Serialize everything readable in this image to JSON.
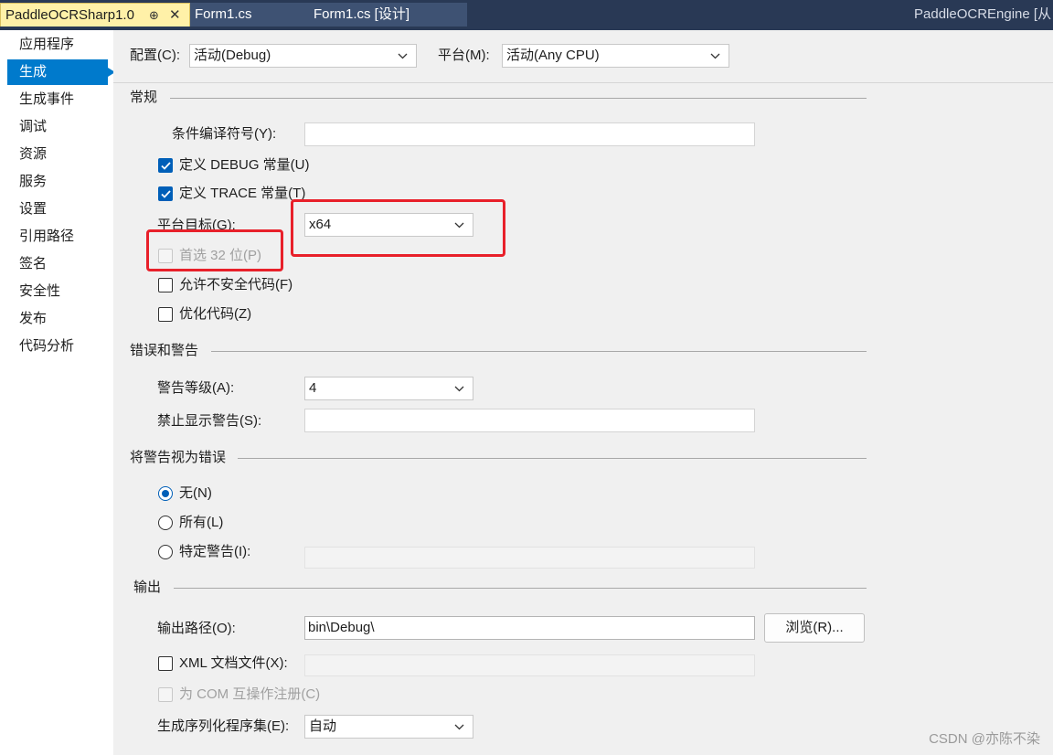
{
  "tabs": {
    "active": "PaddleOCRSharp1.0",
    "pin": "⊕",
    "close": "✕",
    "tab2": "Form1.cs",
    "tab3": "Form1.cs [设计]",
    "right_title": "PaddleOCREngine [从"
  },
  "sidebar": {
    "items": [
      "应用程序",
      "生成",
      "生成事件",
      "调试",
      "资源",
      "服务",
      "设置",
      "引用路径",
      "签名",
      "安全性",
      "发布",
      "代码分析"
    ],
    "selected": "生成"
  },
  "config": {
    "label": "配置(C):",
    "value": "活动(Debug)",
    "platform_label": "平台(M):",
    "platform_value": "活动(Any CPU)"
  },
  "general": {
    "title": "常规",
    "conditional_label": "条件编译符号(Y):",
    "conditional_value": "",
    "define_debug": "定义 DEBUG 常量(U)",
    "define_trace": "定义 TRACE 常量(T)",
    "platform_target_label": "平台目标(G):",
    "platform_target_value": "x64",
    "prefer32": "首选 32 位(P)",
    "unsafe": "允许不安全代码(F)",
    "optimize": "优化代码(Z)"
  },
  "errors": {
    "title": "错误和警告",
    "warning_level_label": "警告等级(A):",
    "warning_level_value": "4",
    "suppress_label": "禁止显示警告(S):",
    "suppress_value": ""
  },
  "treat_warnings": {
    "title": "将警告视为错误",
    "none": "无(N)",
    "all": "所有(L)",
    "specific": "特定警告(I):",
    "specific_value": ""
  },
  "output": {
    "title": "输出",
    "path_label": "输出路径(O):",
    "path_value": "bin\\Debug\\",
    "browse": "浏览(R)...",
    "xml_doc": "XML 文档文件(X):",
    "xml_value": "",
    "com_register": "为 COM 互操作注册(C)",
    "serialization_label": "生成序列化程序集(E):",
    "serialization_value": "自动"
  },
  "watermark": "CSDN @亦陈不染",
  "colors": {
    "accent": "#007acc",
    "highlight": "#e8202a",
    "tab_active": "#fff1a8",
    "tabbar": "#293955"
  }
}
